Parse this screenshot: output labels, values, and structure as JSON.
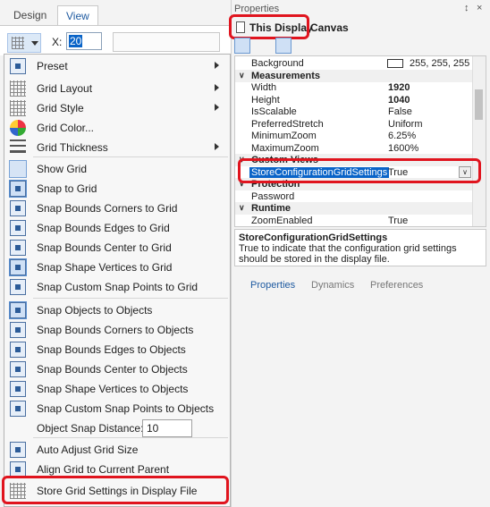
{
  "ribbon": {
    "tabs": [
      "Design",
      "View"
    ],
    "x_label": "X:",
    "x_value": "20"
  },
  "menu": {
    "items": [
      {
        "label": "Preset",
        "icon": "preset-icon",
        "submenu": true
      },
      {
        "label": "Grid Layout",
        "icon": "grid-layout-icon",
        "submenu": true
      },
      {
        "label": "Grid Style",
        "icon": "grid-style-icon",
        "submenu": true
      },
      {
        "label": "Grid Color...",
        "icon": "palette-icon",
        "submenu": false
      },
      {
        "label": "Grid Thickness",
        "icon": "line-thickness-icon",
        "submenu": true
      },
      {
        "label": "Show Grid",
        "icon": "show-grid-icon",
        "submenu": false
      },
      {
        "label": "Snap to Grid",
        "icon": "snap-to-grid-icon",
        "submenu": false
      },
      {
        "label": "Snap Bounds Corners to Grid",
        "icon": "snap-corners-icon",
        "submenu": false
      },
      {
        "label": "Snap Bounds Edges to Grid",
        "icon": "snap-edges-icon",
        "submenu": false
      },
      {
        "label": "Snap Bounds Center to Grid",
        "icon": "snap-center-icon",
        "submenu": false
      },
      {
        "label": "Snap Shape Vertices to Grid",
        "icon": "snap-vertices-icon",
        "submenu": false
      },
      {
        "label": "Snap Custom Snap Points to Grid",
        "icon": "snap-custom-points-icon",
        "submenu": false
      },
      {
        "label": "Snap Objects to Objects",
        "icon": "snap-objects-icon",
        "submenu": false
      },
      {
        "label": "Snap Bounds Corners to Objects",
        "icon": "snap-corners-objects-icon",
        "submenu": false
      },
      {
        "label": "Snap Bounds Edges to Objects",
        "icon": "snap-edges-objects-icon",
        "submenu": false
      },
      {
        "label": "Snap Bounds Center to Objects",
        "icon": "snap-center-objects-icon",
        "submenu": false
      },
      {
        "label": "Snap Shape Vertices to Objects",
        "icon": "snap-vertices-objects-icon",
        "submenu": false
      },
      {
        "label": "Snap Custom Snap Points to Objects",
        "icon": "snap-custom-objects-icon",
        "submenu": false
      },
      {
        "label": "Object Snap Distance:",
        "icon": "",
        "submenu": false
      },
      {
        "label": "Auto Adjust Grid Size",
        "icon": "auto-adjust-icon",
        "submenu": false
      },
      {
        "label": "Align Grid to Current Parent",
        "icon": "align-grid-icon",
        "submenu": false
      },
      {
        "label": "Store Grid Settings in Display File",
        "icon": "store-grid-icon",
        "submenu": false
      }
    ],
    "snap_distance": "10"
  },
  "properties": {
    "title": "Properties",
    "pin": "↕",
    "close": "×",
    "object_name": "This Display",
    "object_type": "Canvas",
    "rows": [
      {
        "kind": "prop",
        "name": "Background",
        "value": "255, 255, 255",
        "swatch": "#ffffff"
      },
      {
        "kind": "cat",
        "name": "Measurements"
      },
      {
        "kind": "prop",
        "name": "Width",
        "value": "1920",
        "bold": true
      },
      {
        "kind": "prop",
        "name": "Height",
        "value": "1040",
        "bold": true
      },
      {
        "kind": "prop",
        "name": "IsScalable",
        "value": "False"
      },
      {
        "kind": "prop",
        "name": "PreferredStretch",
        "value": "Uniform"
      },
      {
        "kind": "prop",
        "name": "MinimumZoom",
        "value": "6.25%"
      },
      {
        "kind": "prop",
        "name": "MaximumZoom",
        "value": "1600%"
      },
      {
        "kind": "cat",
        "name": "Custom Views"
      },
      {
        "kind": "prop",
        "name": "StoreConfigurationGridSettings",
        "value": "True",
        "selected": true
      },
      {
        "kind": "cat",
        "name": "Protection"
      },
      {
        "kind": "prop",
        "name": "Password",
        "value": ""
      },
      {
        "kind": "cat",
        "name": "Runtime"
      },
      {
        "kind": "prop",
        "name": "ZoomEnabled",
        "value": "True"
      }
    ],
    "description_title": "StoreConfigurationGridSettings",
    "description_text": "True to indicate that the configuration grid settings should be stored in the display file.",
    "bottom_tabs": [
      "Properties",
      "Dynamics",
      "Preferences"
    ]
  },
  "colors": {
    "highlight": "#e0141e",
    "selection": "#0a64c8"
  }
}
